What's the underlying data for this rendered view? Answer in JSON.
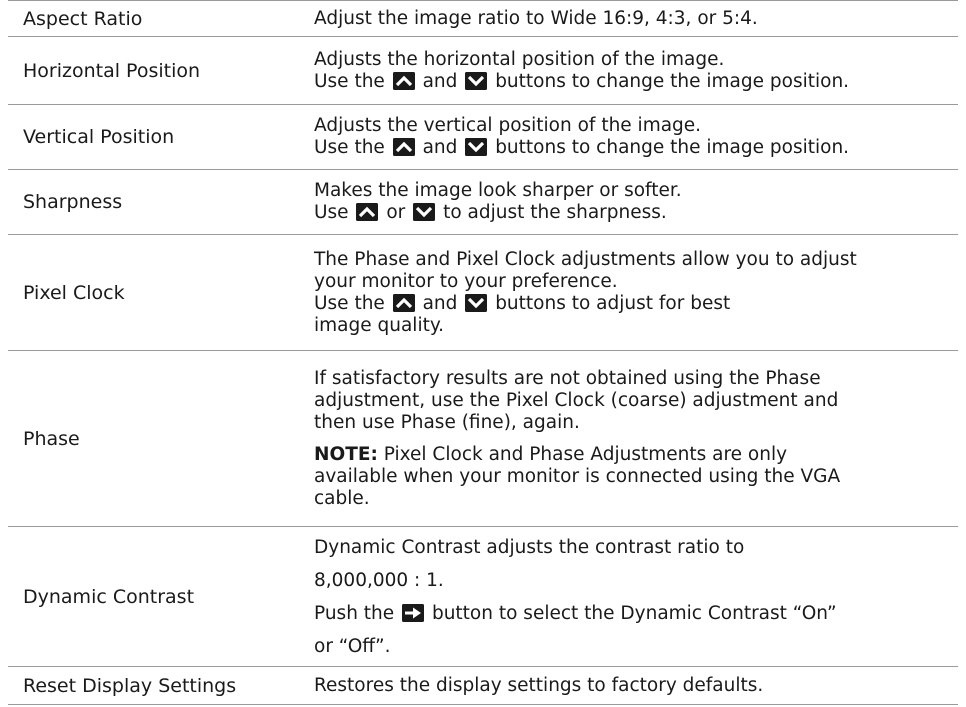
{
  "icons": {
    "up": "up-arrow-button-icon",
    "down": "down-arrow-button-icon",
    "right": "right-arrow-button-icon",
    "color": "#1a1a1a"
  },
  "rows": [
    {
      "name": "Aspect Ratio",
      "desc": [
        "Adjust the image ratio to Wide 16:9, 4:3, or 5:4."
      ]
    },
    {
      "name": "Horizontal Position",
      "desc": [
        "Adjusts the horizontal position of the image."
      ],
      "use_the": "Use the",
      "and": "and",
      "tail": "buttons to change the image position."
    },
    {
      "name": "Vertical Position",
      "desc": [
        "Adjusts the vertical position of the image."
      ],
      "use_the": "Use the",
      "and": "and",
      "tail": "buttons to change the image position."
    },
    {
      "name": "Sharpness",
      "desc": [
        "Makes the image look sharper or softer."
      ],
      "use": "Use",
      "or": "or",
      "tail": "to adjust the sharpness."
    },
    {
      "name": "Pixel Clock",
      "desc": [
        "The Phase and Pixel Clock adjustments allow you to adjust",
        "your monitor to your preference."
      ],
      "use_the": "Use the",
      "and": "and",
      "tail": "buttons to adjust for best",
      "desc_end": "image quality."
    },
    {
      "name": "Phase",
      "desc": [
        "If satisfactory results are not obtained using the Phase",
        "adjustment, use the Pixel Clock (coarse) adjustment and",
        "then use Phase (fine), again."
      ],
      "note_label": "NOTE:",
      "note_text": "Pixel Clock and Phase Adjustments are only",
      "note_more": [
        "available when your monitor is connected using the VGA",
        "cable."
      ]
    },
    {
      "name": "Dynamic Contrast",
      "desc": [
        "Dynamic Contrast adjusts the contrast ratio to",
        "8,000,000 : 1."
      ],
      "push_the": "Push the",
      "tail": "button to select the Dynamic Contrast “On”",
      "desc_end": "or “Off”."
    },
    {
      "name": "Reset Display Settings",
      "desc": [
        "Restores the display settings to factory defaults."
      ]
    }
  ]
}
